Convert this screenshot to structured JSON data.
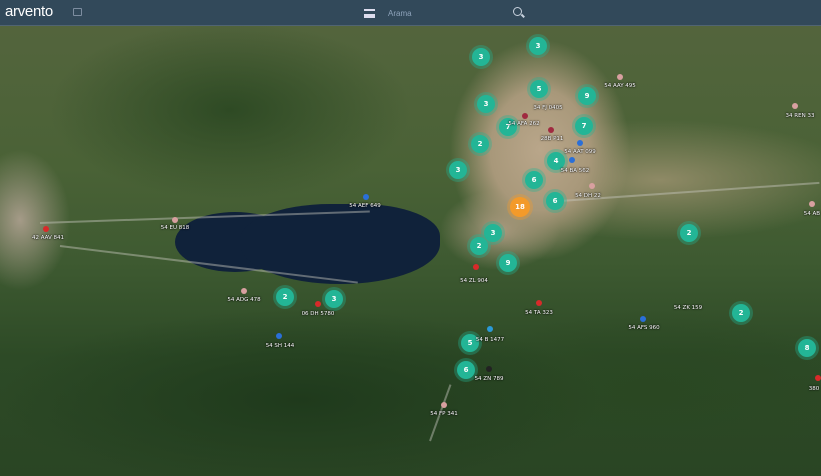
{
  "header": {
    "logo": "arvento",
    "search_placeholder": "Arama",
    "icons": [
      "chat-icon",
      "menu-icon",
      "search-icon"
    ]
  },
  "colors": {
    "cluster": "#23b596",
    "cluster_large": "#f39a2a",
    "marker_red": "#d82a2a",
    "marker_blue": "#2a6fd8",
    "marker_pink": "#d8a0a0",
    "marker_black": "#222222"
  },
  "clusters": [
    "3",
    "3",
    "5",
    "9",
    "3",
    "7",
    "7",
    "2",
    "4",
    "3",
    "6",
    "6",
    "18",
    "3",
    "2",
    "9",
    "2",
    "2",
    "8",
    "2",
    "3",
    "5",
    "6"
  ],
  "vehicles": [
    "54 AAY 495",
    "34 FJ 0405",
    "54 AFA 262",
    "28B P11",
    "54 AAT 099",
    "54 BA 562",
    "54 DH 22",
    "34 REN 33",
    "54 AB",
    "54 AEF 649",
    "54 EU 818",
    "42 AAV 841",
    "54 ADG 478",
    "06 DH 5780",
    "54 SH 144",
    "54 ZL 904",
    "54 TA 323",
    "54 ZK 159",
    "54 AFS 960",
    "54 B 1477",
    "54 ZN 789",
    "54 FP 341",
    "380"
  ]
}
